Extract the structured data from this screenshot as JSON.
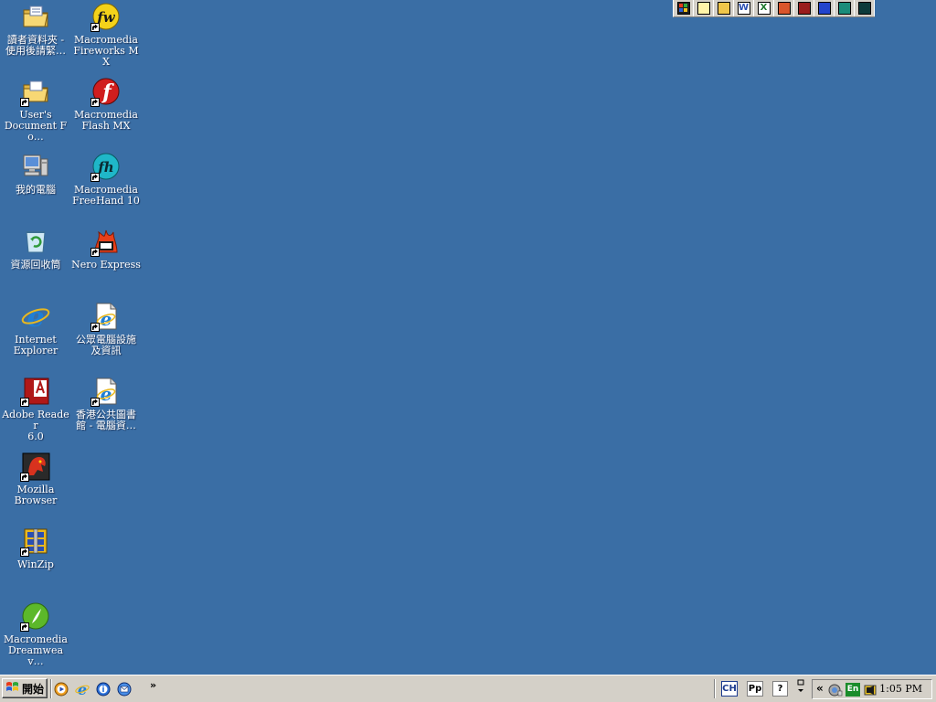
{
  "desktop": {
    "background": "#3A6EA5",
    "icons": [
      {
        "label": "讀者資料夾 -\n使用後請緊…",
        "icon": "folder-icon"
      },
      {
        "label": "User's\nDocument Fo…",
        "icon": "folder-shortcut-icon"
      },
      {
        "label": "我的電腦",
        "icon": "my-computer-icon"
      },
      {
        "label": "資源回收筒",
        "icon": "recycle-bin-icon"
      },
      {
        "label": "Internet\nExplorer",
        "icon": "internet-explorer-icon"
      },
      {
        "label": "Adobe Reader\n6.0",
        "icon": "adobe-reader-icon"
      },
      {
        "label": "Mozilla\nBrowser",
        "icon": "mozilla-icon"
      },
      {
        "label": "WinZip",
        "icon": "winzip-icon"
      },
      {
        "label": "Macromedia\nDreamweav…",
        "icon": "dreamweaver-icon"
      },
      {
        "label": "Macromedia\nFireworks MX",
        "icon": "fireworks-icon"
      },
      {
        "label": "Macromedia\nFlash MX",
        "icon": "flash-icon"
      },
      {
        "label": "Macromedia\nFreeHand 10",
        "icon": "freehand-icon"
      },
      {
        "label": "Nero Express",
        "icon": "nero-icon"
      },
      {
        "label": "公眾電腦設施\n及資訊",
        "icon": "ie-page-icon"
      },
      {
        "label": "香港公共圖書\n館 - 電腦資…",
        "icon": "ie-page-icon"
      }
    ]
  },
  "office_bar": {
    "buttons": [
      {
        "icon": "office-logo-icon",
        "glyph": "",
        "color": "#1f1f1f"
      },
      {
        "icon": "new-office-document-icon",
        "glyph": "",
        "color": "#fff4a8"
      },
      {
        "icon": "open-office-document-icon",
        "glyph": "",
        "color": "#f0c64a"
      },
      {
        "icon": "word-icon",
        "glyph": "W",
        "color": "#2a4fb3"
      },
      {
        "icon": "excel-icon",
        "glyph": "X",
        "color": "#1f7a2e"
      },
      {
        "icon": "powerpoint-icon",
        "glyph": "",
        "color": "#d9552b"
      },
      {
        "icon": "access-icon",
        "glyph": "",
        "color": "#9a1c1c"
      },
      {
        "icon": "outlook-icon",
        "glyph": "",
        "color": "#2244cc"
      },
      {
        "icon": "publisher-icon",
        "glyph": "",
        "color": "#1a8c7a"
      },
      {
        "icon": "frontpage-icon",
        "glyph": "",
        "color": "#0d3b3b"
      }
    ]
  },
  "taskbar": {
    "start_label": "開始",
    "quick_launch": [
      "media-player-icon",
      "internet-explorer-icon",
      "info-icon",
      "outlook-express-icon"
    ],
    "more_label": "»",
    "language_bar": {
      "lang_label": "CH",
      "ime_label": "Pp",
      "help_label": "?",
      "restore_label": "▫\n▾"
    },
    "tray": {
      "expand_label": "«",
      "input_label": "En",
      "icons": [
        "network-icon",
        "speaker-icon"
      ],
      "clock": "1:05 PM"
    }
  }
}
